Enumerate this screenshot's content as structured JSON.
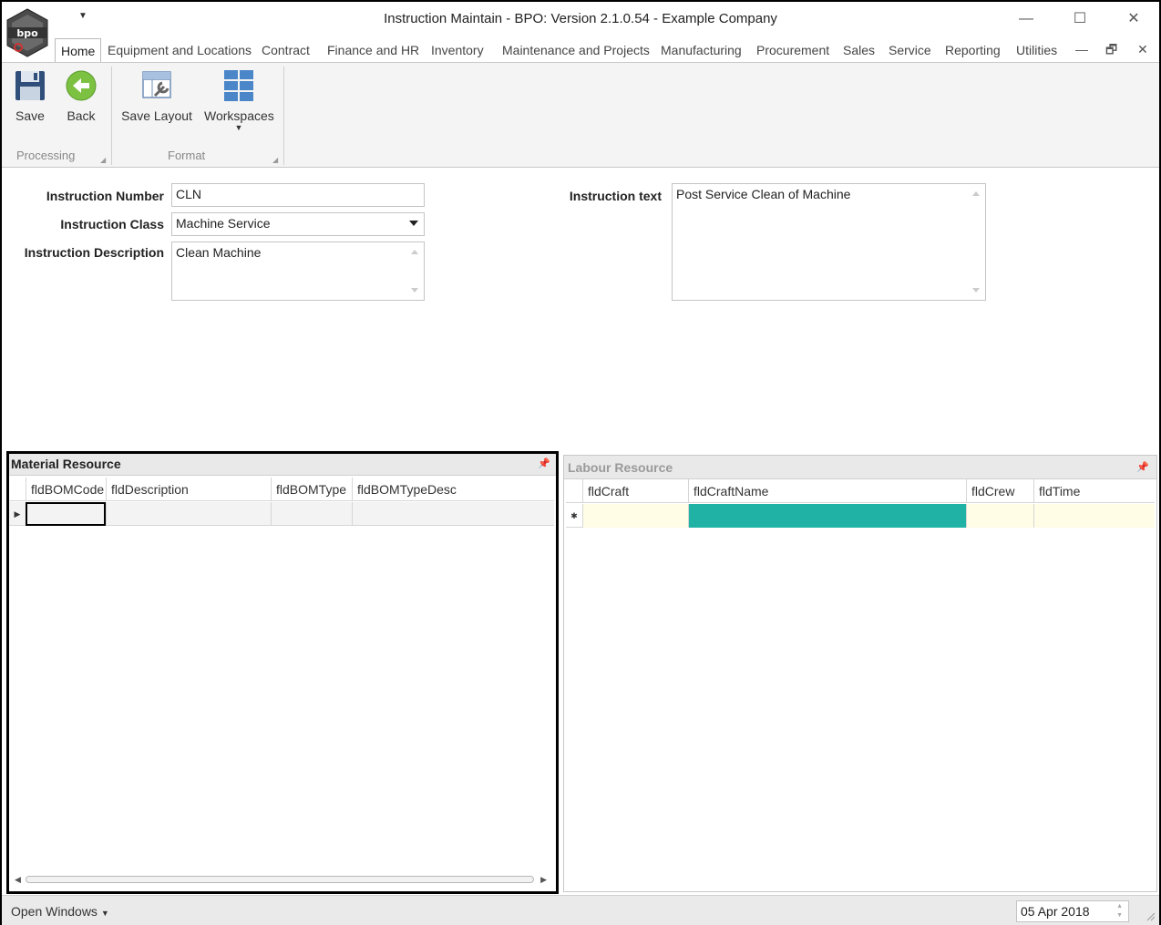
{
  "window": {
    "title": "Instruction Maintain - BPO: Version 2.1.0.54 - Example Company",
    "logo_text": "bpo",
    "minimize": "—",
    "maximize": "☐",
    "close": "✕"
  },
  "menu": {
    "tabs": [
      "Home",
      "Equipment and Locations",
      "Contract",
      "Finance and HR",
      "Inventory",
      "Maintenance and Projects",
      "Manufacturing",
      "Procurement",
      "Sales",
      "Service",
      "Reporting",
      "Utilities"
    ],
    "active_tab": "Home"
  },
  "ribbon": {
    "save_label": "Save",
    "back_label": "Back",
    "save_layout_label": "Save Layout",
    "workspaces_label": "Workspaces",
    "processing_group": "Processing",
    "format_group": "Format"
  },
  "form": {
    "instruction_number_label": "Instruction Number",
    "instruction_number_value": "CLN",
    "instruction_class_label": "Instruction Class",
    "instruction_class_value": "Machine Service",
    "instruction_description_label": "Instruction Description",
    "instruction_description_value": "Clean Machine",
    "instruction_text_label": "Instruction text",
    "instruction_text_value": "Post Service Clean of Machine"
  },
  "material_resource": {
    "title": "Material Resource",
    "columns": [
      "fldBOMCode",
      "fldDescription",
      "fldBOMType",
      "fldBOMTypeDesc"
    ]
  },
  "labour_resource": {
    "title": "Labour Resource",
    "columns": [
      "fldCraft",
      "fldCraftName",
      "fldCrew",
      "fldTime"
    ],
    "new_row_marker": "✱"
  },
  "statusbar": {
    "open_windows": "Open Windows",
    "date": "05 Apr 2018"
  },
  "colors": {
    "selected_cell": "#20b2a5",
    "new_row": "#fffde6"
  }
}
